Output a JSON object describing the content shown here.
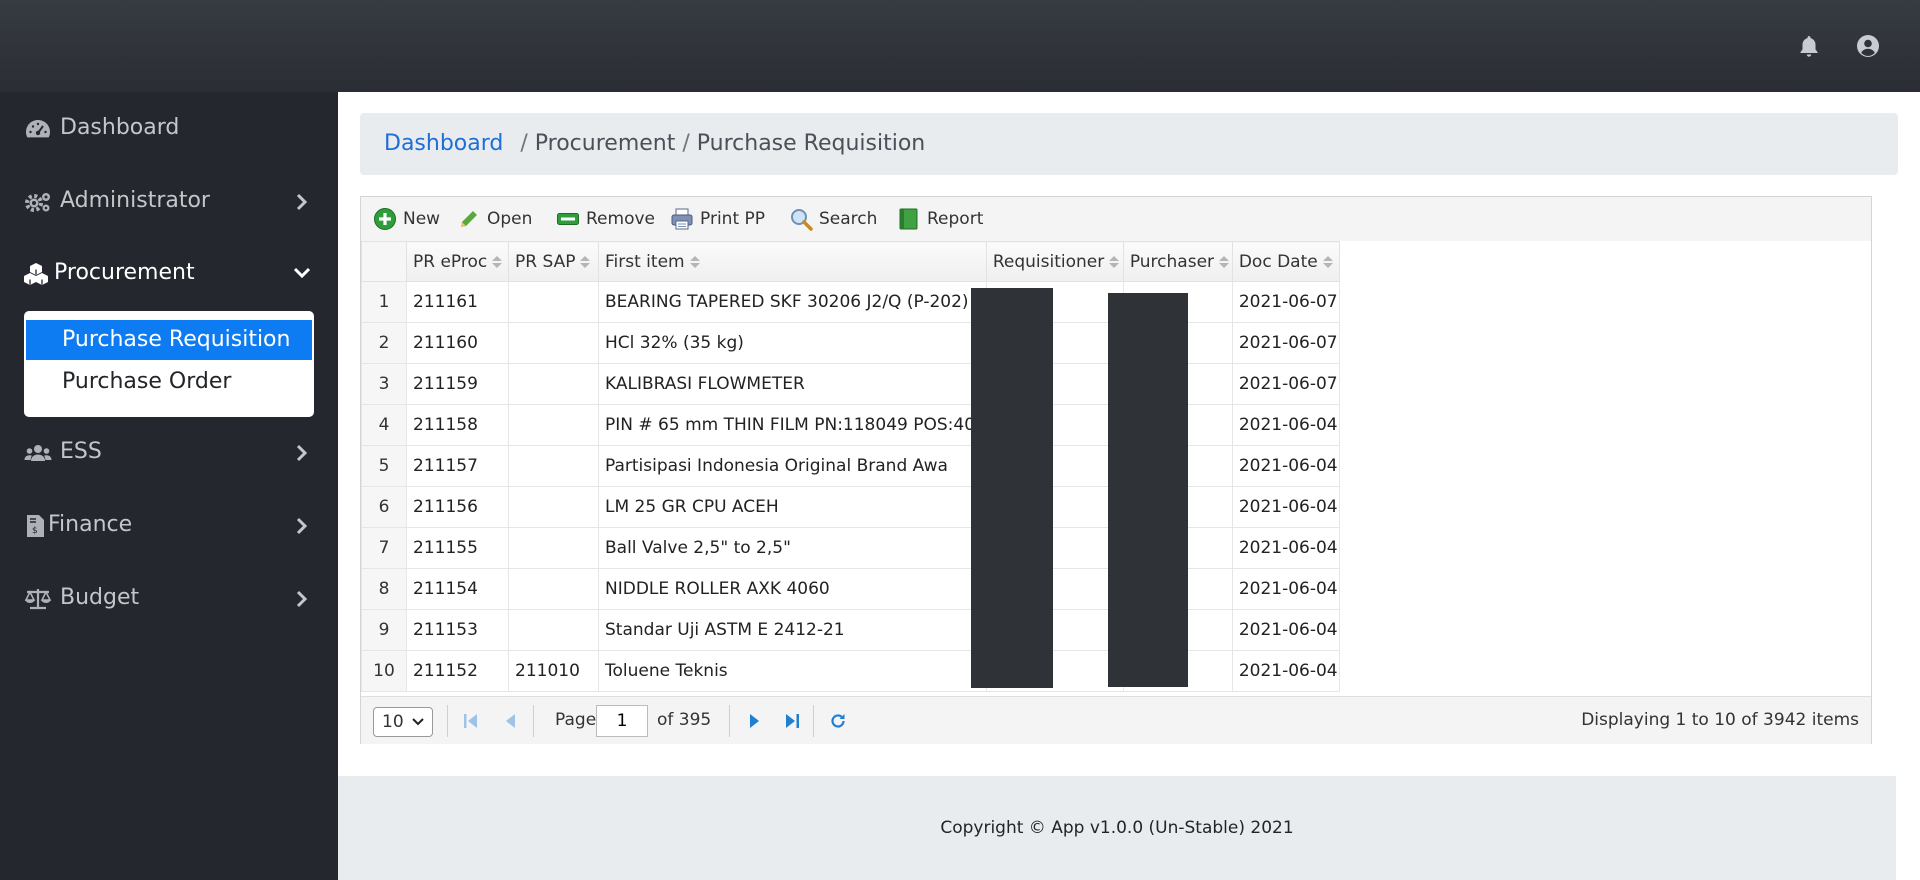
{
  "topbar": {
    "icons": [
      "bell-icon",
      "user-circle-icon"
    ]
  },
  "sidebar": {
    "items": [
      {
        "label": "Dashboard",
        "icon": "tachometer-icon"
      },
      {
        "label": "Administrator",
        "icon": "cogs-icon"
      },
      {
        "label": "Procurement",
        "icon": "cubes-icon"
      },
      {
        "label": "ESS",
        "icon": "users-icon"
      },
      {
        "label": "Finance",
        "icon": "invoice-icon"
      },
      {
        "label": "Budget",
        "icon": "balance-scale-icon"
      }
    ],
    "submenu": [
      {
        "label": "Purchase Requisition"
      },
      {
        "label": "Purchase Order"
      }
    ]
  },
  "breadcrumb": {
    "home": "Dashboard",
    "separator": "/",
    "section": "Procurement",
    "page": "Purchase Requisition"
  },
  "toolbar": {
    "new": "New",
    "open": "Open",
    "remove": "Remove",
    "print": "Print PP",
    "search": "Search",
    "report": "Report"
  },
  "grid": {
    "columns": [
      "PR eProc",
      "PR SAP",
      "First item",
      "Requisitioner",
      "Purchaser",
      "Doc Date"
    ],
    "rows": [
      {
        "n": "1",
        "pr_eproc": "211161",
        "pr_sap": "",
        "first_item": "BEARING TAPERED SKF 30206 J2/Q (P-202)",
        "doc_date": "2021-06-07"
      },
      {
        "n": "2",
        "pr_eproc": "211160",
        "pr_sap": "",
        "first_item": "HCl 32% (35 kg)",
        "doc_date": "2021-06-07"
      },
      {
        "n": "3",
        "pr_eproc": "211159",
        "pr_sap": "",
        "first_item": "KALIBRASI FLOWMETER",
        "doc_date": "2021-06-07"
      },
      {
        "n": "4",
        "pr_eproc": "211158",
        "pr_sap": "",
        "first_item": "PIN # 65 mm THIN FILM PN:118049 POS:401",
        "doc_date": "2021-06-04"
      },
      {
        "n": "5",
        "pr_eproc": "211157",
        "pr_sap": "",
        "first_item": "Partisipasi Indonesia Original Brand Awa",
        "doc_date": "2021-06-04"
      },
      {
        "n": "6",
        "pr_eproc": "211156",
        "pr_sap": "",
        "first_item": "LM 25 GR CPU ACEH",
        "doc_date": "2021-06-04"
      },
      {
        "n": "7",
        "pr_eproc": "211155",
        "pr_sap": "",
        "first_item": "Ball Valve 2,5\" to 2,5\"",
        "doc_date": "2021-06-04"
      },
      {
        "n": "8",
        "pr_eproc": "211154",
        "pr_sap": "",
        "first_item": "NIDDLE ROLLER AXK 4060",
        "doc_date": "2021-06-04"
      },
      {
        "n": "9",
        "pr_eproc": "211153",
        "pr_sap": "",
        "first_item": "Standar Uji ASTM  E 2412-21",
        "doc_date": "2021-06-04"
      },
      {
        "n": "10",
        "pr_eproc": "211152",
        "pr_sap": "211010",
        "first_item": "Toluene Teknis",
        "doc_date": "2021-06-04"
      }
    ]
  },
  "pager": {
    "page_size": "10",
    "page_label": "Page",
    "current_page": "1",
    "of_label": "of 395",
    "summary": "Displaying 1 to 10 of 3942 items"
  },
  "footer": {
    "text": "Copyright © App v1.0.0 (Un-Stable) 2021"
  },
  "colors": {
    "sidebar_bg": "#24272d",
    "topbar_bg": "#2f3238",
    "accent": "#0d7cf2",
    "link": "#1d6ed8"
  }
}
